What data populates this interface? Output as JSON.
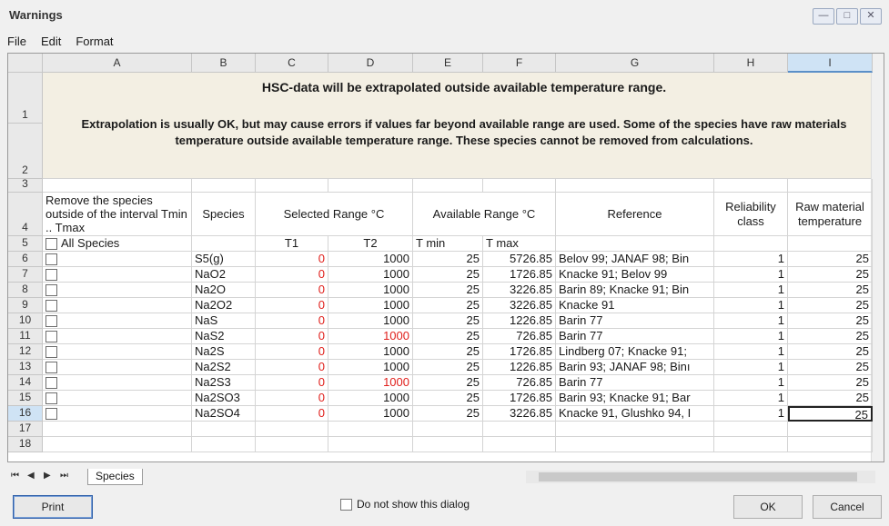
{
  "window": {
    "title": "Warnings",
    "buttons": [
      "—",
      "□",
      "✕"
    ]
  },
  "menu": [
    "File",
    "Edit",
    "Format"
  ],
  "columns": [
    "A",
    "B",
    "C",
    "D",
    "E",
    "F",
    "G",
    "H",
    "I"
  ],
  "rows": [
    "1",
    "2",
    "3",
    "4",
    "5",
    "6",
    "7",
    "8",
    "9",
    "10",
    "11",
    "12",
    "13",
    "14",
    "15",
    "16",
    "17",
    "18"
  ],
  "banner": {
    "line1": "HSC-data will be extrapolated outside available temperature range.",
    "line2": "Extrapolation is usually OK, but may cause errors if values far beyond available range are used. Some of the species have raw materials temperature outside available temperature range. These species cannot be removed from calculations."
  },
  "headers": {
    "remove": "Remove the species outside of the interval Tmin .. Tmax",
    "species": "Species",
    "selected": "Selected Range °C",
    "available": "Available Range °C",
    "reference": "Reference",
    "reliability": "Reliability class",
    "raw": "Raw material temperature"
  },
  "subheaders": {
    "all_species": "All Species",
    "t1": "T1",
    "t2": "T2",
    "tmin": "T min",
    "tmax": "T max"
  },
  "data": [
    {
      "species": "S5(g)",
      "t1": "0",
      "t2": "1000",
      "tmin": "25",
      "tmax": "5726.85",
      "ref": "Belov 99; JANAF 98; Bin",
      "rel": "1",
      "raw": "25",
      "t2red": false
    },
    {
      "species": "NaO2",
      "t1": "0",
      "t2": "1000",
      "tmin": "25",
      "tmax": "1726.85",
      "ref": "Knacke 91; Belov 99",
      "rel": "1",
      "raw": "25",
      "t2red": false
    },
    {
      "species": "Na2O",
      "t1": "0",
      "t2": "1000",
      "tmin": "25",
      "tmax": "3226.85",
      "ref": "Barin 89; Knacke 91; Bin",
      "rel": "1",
      "raw": "25",
      "t2red": false
    },
    {
      "species": "Na2O2",
      "t1": "0",
      "t2": "1000",
      "tmin": "25",
      "tmax": "3226.85",
      "ref": "Knacke 91",
      "rel": "1",
      "raw": "25",
      "t2red": false
    },
    {
      "species": "NaS",
      "t1": "0",
      "t2": "1000",
      "tmin": "25",
      "tmax": "1226.85",
      "ref": "Barin 77",
      "rel": "1",
      "raw": "25",
      "t2red": false
    },
    {
      "species": "NaS2",
      "t1": "0",
      "t2": "1000",
      "tmin": "25",
      "tmax": "726.85",
      "ref": "Barin 77",
      "rel": "1",
      "raw": "25",
      "t2red": true
    },
    {
      "species": "Na2S",
      "t1": "0",
      "t2": "1000",
      "tmin": "25",
      "tmax": "1726.85",
      "ref": "Lindberg 07; Knacke 91;",
      "rel": "1",
      "raw": "25",
      "t2red": false
    },
    {
      "species": "Na2S2",
      "t1": "0",
      "t2": "1000",
      "tmin": "25",
      "tmax": "1226.85",
      "ref": "Barin 93; JANAF 98; Binı",
      "rel": "1",
      "raw": "25",
      "t2red": false
    },
    {
      "species": "Na2S3",
      "t1": "0",
      "t2": "1000",
      "tmin": "25",
      "tmax": "726.85",
      "ref": "Barin 77",
      "rel": "1",
      "raw": "25",
      "t2red": true
    },
    {
      "species": "Na2SO3",
      "t1": "0",
      "t2": "1000",
      "tmin": "25",
      "tmax": "1726.85",
      "ref": "Barin 93; Knacke 91; Bar",
      "rel": "1",
      "raw": "25",
      "t2red": false
    },
    {
      "species": "Na2SO4",
      "t1": "0",
      "t2": "1000",
      "tmin": "25",
      "tmax": "3226.85",
      "ref": "Knacke 91, Glushko 94, I",
      "rel": "1",
      "raw": "25",
      "t2red": false
    }
  ],
  "sheet_tab": "Species",
  "nav": [
    "⏮",
    "◀",
    "▶",
    "⏭"
  ],
  "bottom": {
    "print": "Print",
    "dont_show": "Do not show this dialog",
    "ok": "OK",
    "cancel": "Cancel"
  },
  "colors": {
    "red": "#e0201c",
    "banner": "#f3efe3",
    "selected_header": "#cfe3f5"
  }
}
